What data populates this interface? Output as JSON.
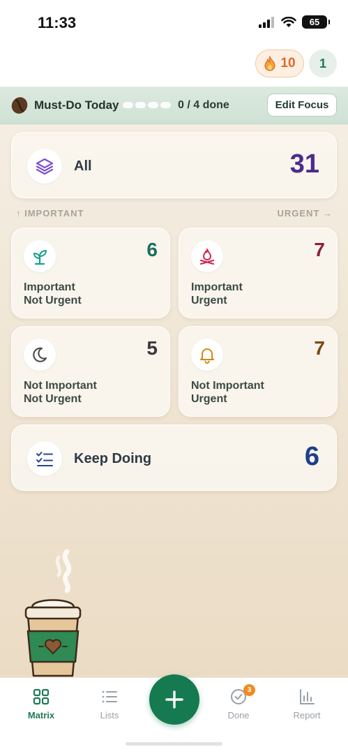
{
  "status_bar": {
    "time": "11:33",
    "battery": "65"
  },
  "header": {
    "streak_count": "10",
    "profile_initial": "1"
  },
  "focus": {
    "title": "Must-Do Today",
    "progress": "0 / 4 done",
    "done": 0,
    "total": 4,
    "edit_label": "Edit Focus"
  },
  "all": {
    "label": "All",
    "count": "31",
    "color": "#4b2c8c"
  },
  "axes": {
    "important": "↑ IMPORTANT",
    "urgent": "URGENT →"
  },
  "quadrants": [
    {
      "line1": "Important",
      "line2": "Not Urgent",
      "count": "6",
      "color": "#17705e",
      "icon": "sprout-icon"
    },
    {
      "line1": "Important",
      "line2": "Urgent",
      "count": "7",
      "color": "#8c1f3a",
      "icon": "campfire-icon"
    },
    {
      "line1": "Not Important",
      "line2": "Not Urgent",
      "count": "5",
      "color": "#3a3a3a",
      "icon": "moon-icon"
    },
    {
      "line1": "Not Important",
      "line2": "Urgent",
      "count": "7",
      "color": "#7a4a14",
      "icon": "bell-icon"
    }
  ],
  "keep_doing": {
    "label": "Keep Doing",
    "count": "6",
    "color": "#1d3f8c"
  },
  "tabs": [
    {
      "label": "Matrix",
      "active": true,
      "icon": "grid-icon"
    },
    {
      "label": "Lists",
      "active": false,
      "icon": "list-icon"
    },
    {
      "label": "Done",
      "active": false,
      "icon": "check-circle-icon",
      "badge": "3"
    },
    {
      "label": "Report",
      "active": false,
      "icon": "bar-chart-icon"
    }
  ],
  "colors": {
    "accent": "#157a4f",
    "streak": "#e2672a"
  }
}
